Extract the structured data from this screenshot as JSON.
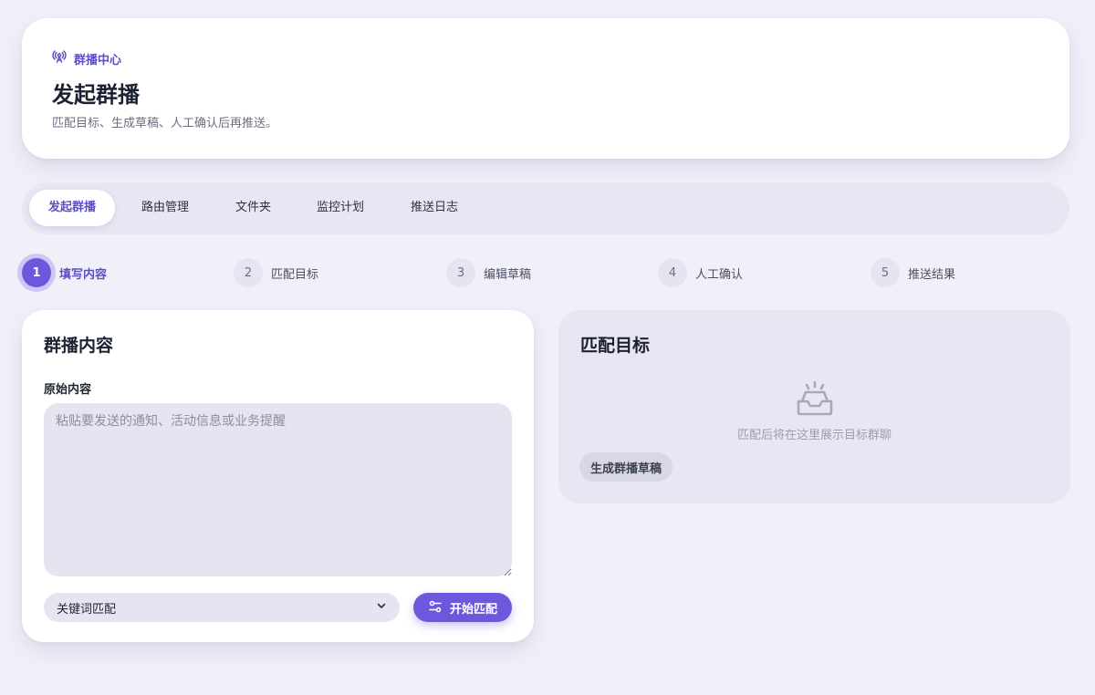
{
  "header": {
    "eyebrow": "群播中心",
    "title": "发起群播",
    "subtitle": "匹配目标、生成草稿、人工确认后再推送。"
  },
  "tabs": [
    {
      "label": "发起群播",
      "active": true
    },
    {
      "label": "路由管理",
      "active": false
    },
    {
      "label": "文件夹",
      "active": false
    },
    {
      "label": "监控计划",
      "active": false
    },
    {
      "label": "推送日志",
      "active": false
    }
  ],
  "steps": [
    {
      "number": "1",
      "label": "填写内容",
      "active": true
    },
    {
      "number": "2",
      "label": "匹配目标",
      "active": false
    },
    {
      "number": "3",
      "label": "编辑草稿",
      "active": false
    },
    {
      "number": "4",
      "label": "人工确认",
      "active": false
    },
    {
      "number": "5",
      "label": "推送结果",
      "active": false
    }
  ],
  "content_card": {
    "title": "群播内容",
    "field_label": "原始内容",
    "textarea_value": "",
    "textarea_placeholder": "粘贴要发送的通知、活动信息或业务提醒",
    "match_mode_selected": "关键词匹配",
    "start_button": "开始匹配"
  },
  "target_card": {
    "title": "匹配目标",
    "empty_text": "匹配后将在这里展示目标群聊",
    "draft_button": "生成群播草稿"
  },
  "icons": {
    "eyebrow": "broadcast-icon",
    "select": "chevron-down-icon",
    "start_button": "sliders-icon",
    "empty": "empty-inbox-icon"
  },
  "colors": {
    "accent": "#6b58dd",
    "background": "#f1f0f9",
    "muted_surface": "#e8e6f3"
  }
}
